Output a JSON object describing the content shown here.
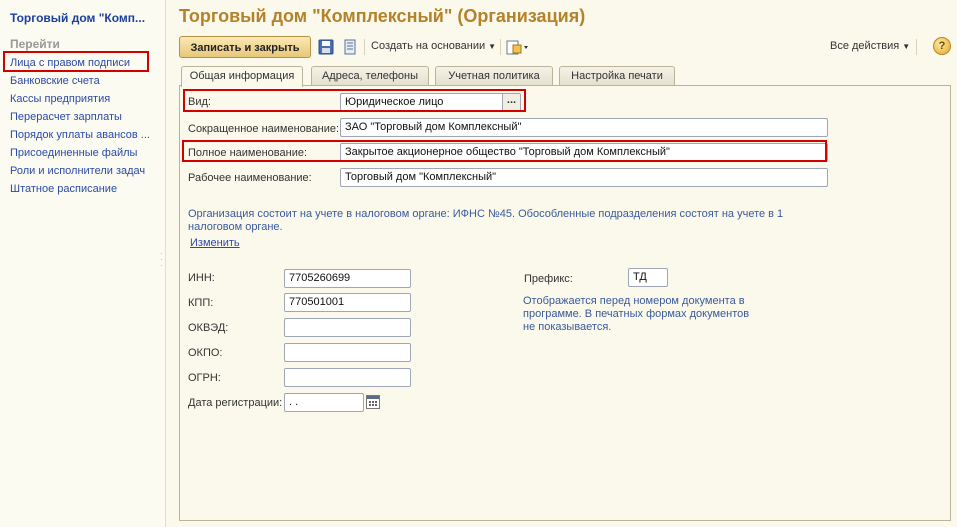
{
  "sidebar": {
    "title": "Торговый дом \"Комп...",
    "section": "Перейти",
    "items": [
      {
        "label": "Лица с правом подписи"
      },
      {
        "label": "Банковские счета"
      },
      {
        "label": "Кассы предприятия"
      },
      {
        "label": "Перерасчет зарплаты"
      },
      {
        "label": "Порядок уплаты авансов ..."
      },
      {
        "label": "Присоединенные файлы"
      },
      {
        "label": "Роли и исполнители задач"
      },
      {
        "label": "Штатное расписание"
      }
    ]
  },
  "page_title": "Торговый дом \"Комплексный\" (Организация)",
  "toolbar": {
    "save_close_label": "Записать и закрыть",
    "create_based_label": "Создать на основании",
    "all_actions_label": "Все действия",
    "help_label": "?"
  },
  "tabs": [
    {
      "label": "Общая информация",
      "active": true
    },
    {
      "label": "Адреса, телефоны",
      "active": false
    },
    {
      "label": "Учетная политика",
      "active": false
    },
    {
      "label": "Настройка печати",
      "active": false
    }
  ],
  "form": {
    "vid": {
      "label": "Вид:",
      "value": "Юридическое лицо",
      "button": "..."
    },
    "short_name": {
      "label": "Сокращенное наименование:",
      "value": "ЗАО \"Торговый дом Комплексный\""
    },
    "full_name": {
      "label": "Полное наименование:",
      "value": "Закрытое акционерное общество \"Торговый дом Комплексный\""
    },
    "work_name": {
      "label": "Рабочее наименование:",
      "value": "Торговый дом \"Комплексный\""
    },
    "tax_info": "Организация состоит на учете в налоговом органе: ИФНС №45. Обособленные подразделения состоят на учете в 1 налоговом органе.",
    "change_link": "Изменить",
    "inn": {
      "label": "ИНН:",
      "value": "7705260699"
    },
    "kpp": {
      "label": "КПП:",
      "value": "770501001"
    },
    "okved": {
      "label": "ОКВЭД:",
      "value": ""
    },
    "okpo": {
      "label": "ОКПО:",
      "value": ""
    },
    "ogrn": {
      "label": "ОГРН:",
      "value": ""
    },
    "reg_date": {
      "label": "Дата регистрации:",
      "value": " .  ."
    },
    "prefix": {
      "label": "Префикс:",
      "value": "ТД"
    },
    "prefix_hint": "Отображается перед номером документа в программе. В печатных формах документов не показывается."
  },
  "colors": {
    "highlight": "#d40000",
    "title": "#b4822a",
    "link": "#2a4aa8"
  }
}
